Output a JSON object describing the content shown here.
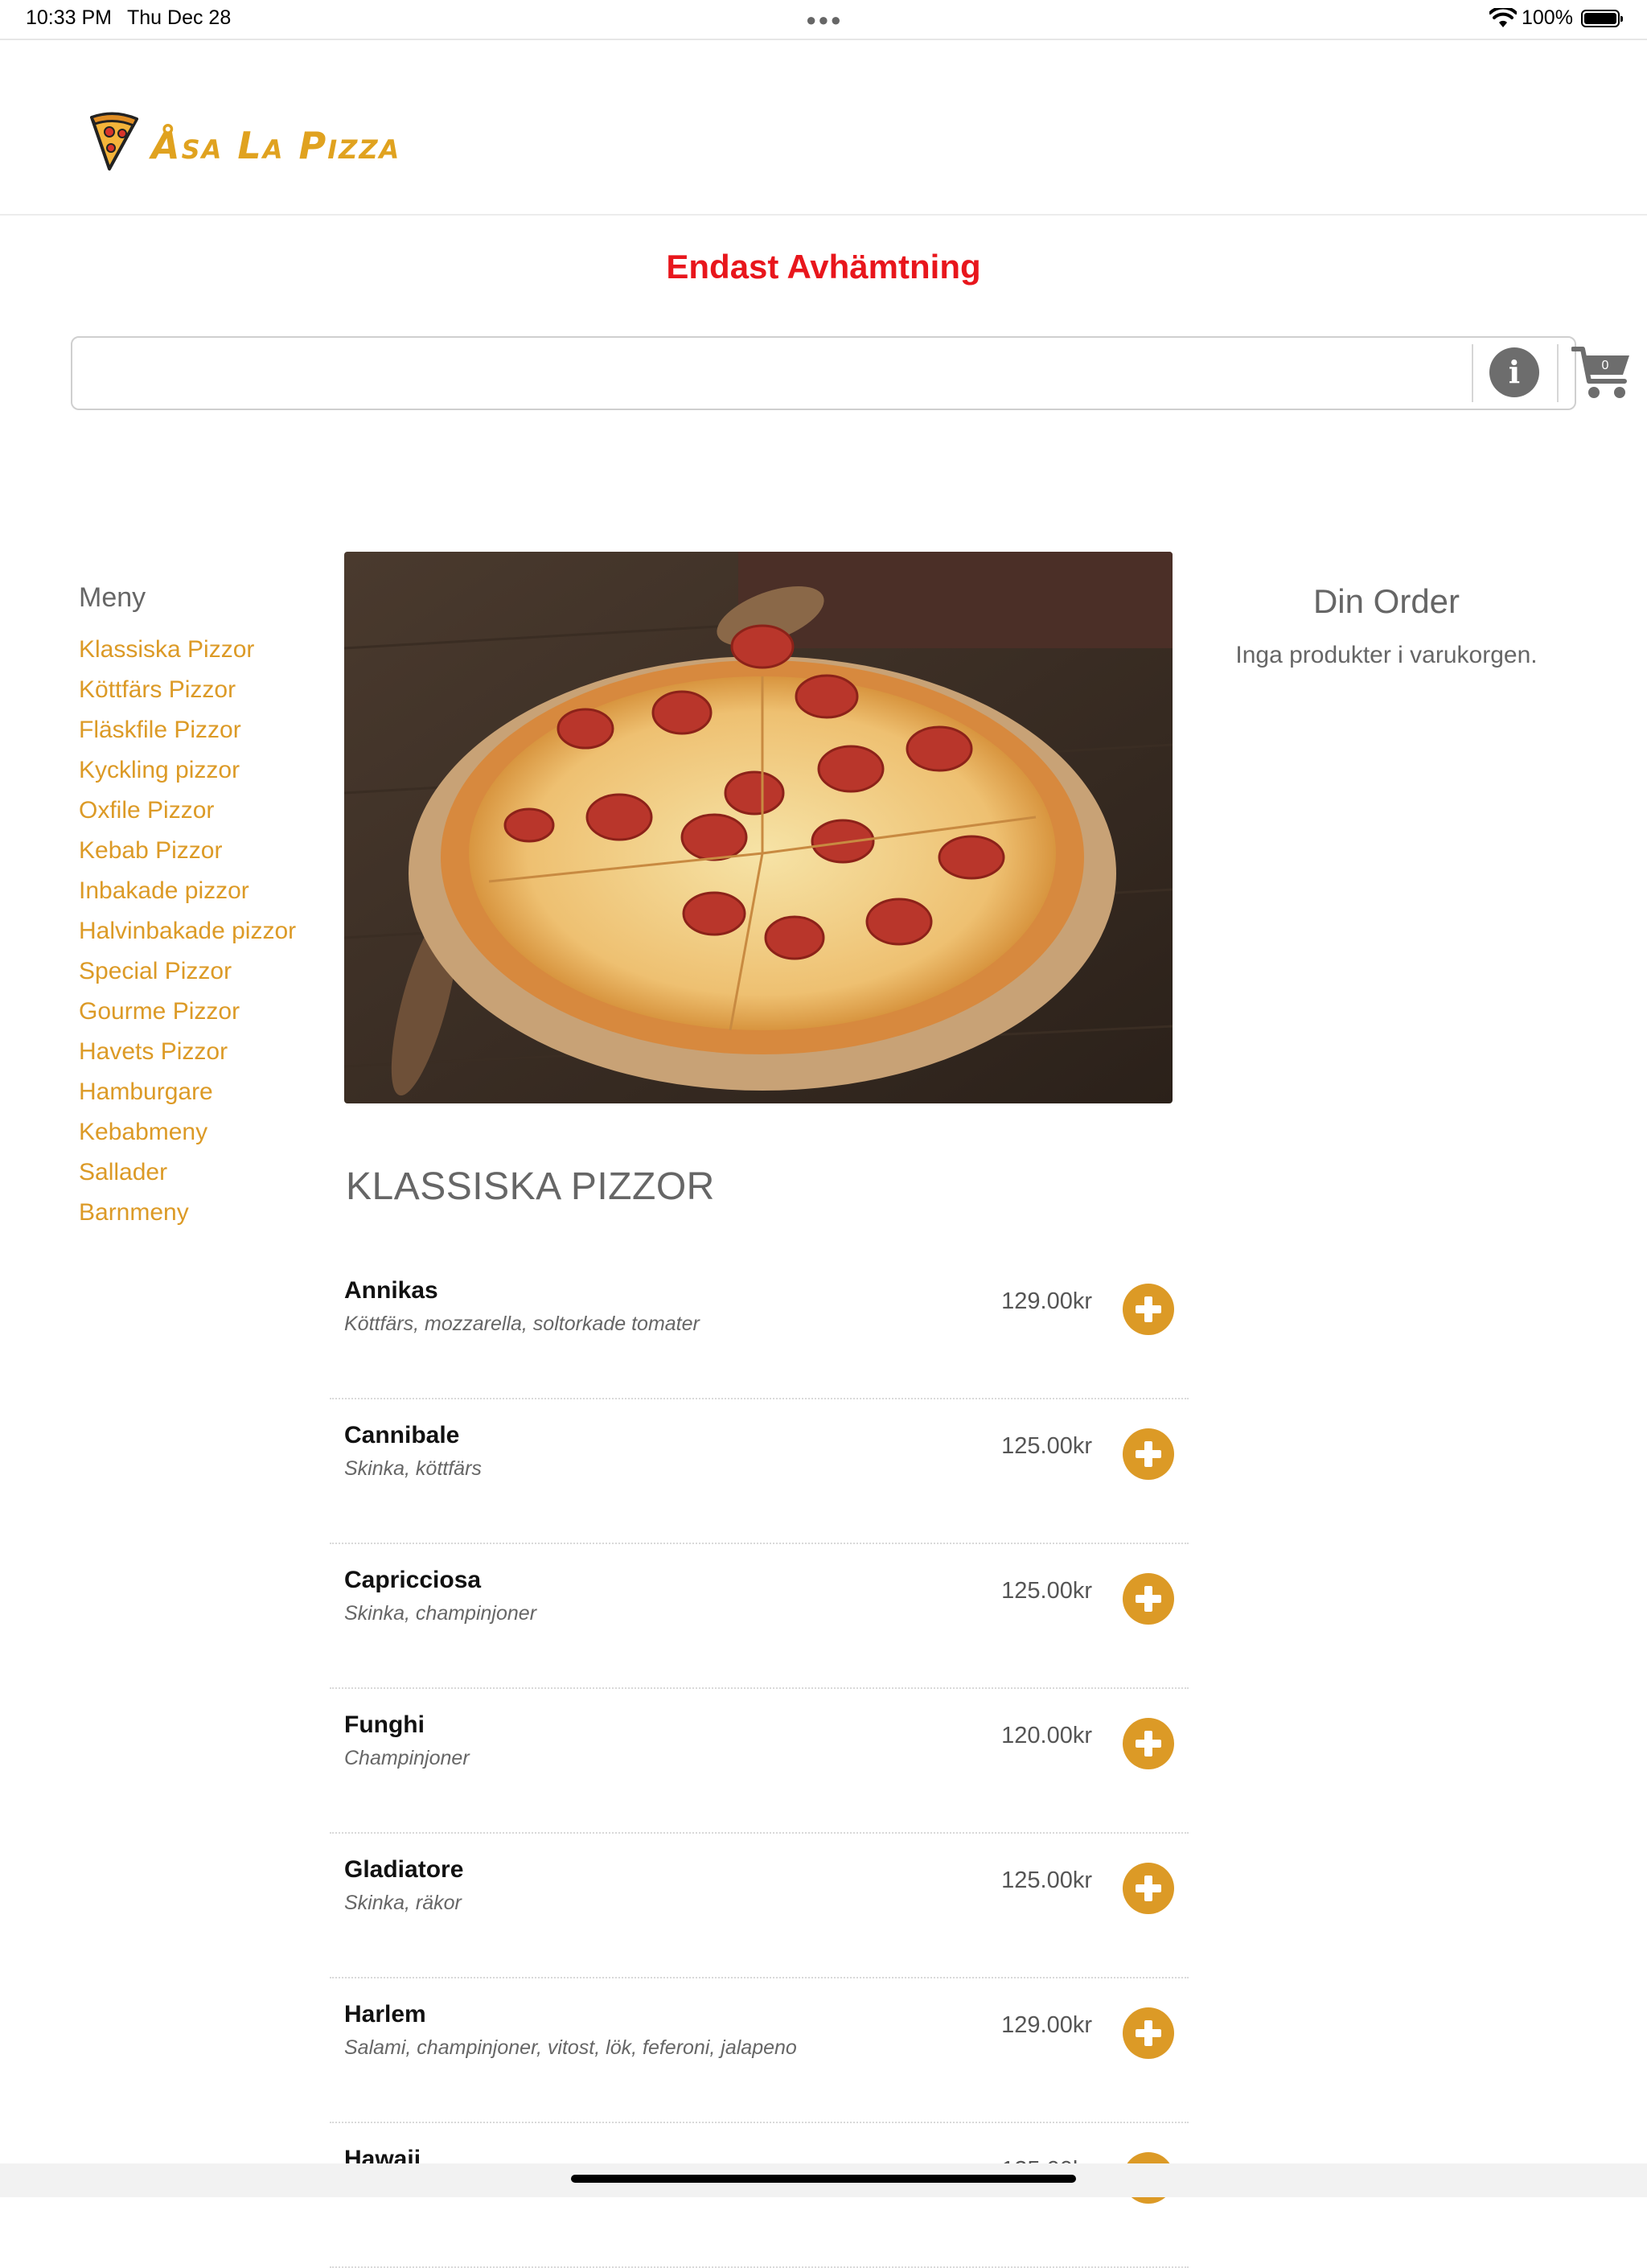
{
  "status_bar": {
    "time": "10:33 PM",
    "date": "Thu Dec 28",
    "battery": "100%"
  },
  "brand": {
    "name": "Åsa La Pizza",
    "accent": "#dc9a26"
  },
  "notice": {
    "text": "Endast Avhämtning",
    "color": "#e8161c"
  },
  "cart": {
    "count": "0"
  },
  "sidebar": {
    "title": "Meny",
    "items": [
      {
        "label": "Klassiska Pizzor"
      },
      {
        "label": "Köttfärs Pizzor"
      },
      {
        "label": "Fläskfile Pizzor"
      },
      {
        "label": "Kyckling pizzor"
      },
      {
        "label": "Oxfile Pizzor"
      },
      {
        "label": "Kebab Pizzor"
      },
      {
        "label": "Inbakade pizzor"
      },
      {
        "label": "Halvinbakade pizzor"
      },
      {
        "label": "Special Pizzor"
      },
      {
        "label": "Gourme Pizzor"
      },
      {
        "label": "Havets Pizzor"
      },
      {
        "label": "Hamburgare"
      },
      {
        "label": "Kebabmeny"
      },
      {
        "label": "Sallader"
      },
      {
        "label": "Barnmeny"
      }
    ]
  },
  "order": {
    "title": "Din Order",
    "empty_text": "Inga produkter i varukorgen."
  },
  "category": {
    "title": "KLASSISKA PIZZOR",
    "items": [
      {
        "name": "Annikas",
        "desc": "Köttfärs, mozzarella, soltorkade tomater",
        "price": "129.00kr"
      },
      {
        "name": "Cannibale",
        "desc": "Skinka, köttfärs",
        "price": "125.00kr"
      },
      {
        "name": "Capricciosa",
        "desc": "Skinka, champinjoner",
        "price": "125.00kr"
      },
      {
        "name": "Funghi",
        "desc": "Champinjoner",
        "price": "120.00kr"
      },
      {
        "name": "Gladiatore",
        "desc": "Skinka, räkor",
        "price": "125.00kr"
      },
      {
        "name": "Harlem",
        "desc": "Salami, champinjoner, vitost, lök, feferoni, jalapeno",
        "price": "129.00kr"
      },
      {
        "name": "Hawaii",
        "desc": "",
        "price": "125.00kr"
      }
    ]
  }
}
